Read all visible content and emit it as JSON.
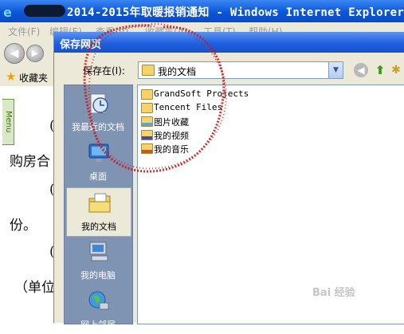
{
  "ie": {
    "title": "2014-2015年取暖报销通知 - Windows Internet Explorer",
    "menu": [
      "文件(F)",
      "编辑(E)",
      "查看(V)",
      "收藏夹(A)",
      "工具(T)",
      "帮助(H)"
    ],
    "favorites_label": "收藏夹",
    "sidebar_tab": "Menu",
    "document_lines": [
      "(",
      "购房合",
      "(",
      "份。",
      "(",
      "（单位"
    ]
  },
  "dialog": {
    "title": "保存网页",
    "save_in_label": "保存在(I):",
    "save_in_value": "我的文档",
    "places": [
      {
        "label": "我最近的文档",
        "icon": "recent-documents-icon"
      },
      {
        "label": "桌面",
        "icon": "desktop-icon"
      },
      {
        "label": "我的文档",
        "icon": "my-documents-icon"
      },
      {
        "label": "我的电脑",
        "icon": "my-computer-icon"
      },
      {
        "label": "网上邻居",
        "icon": "network-places-icon"
      }
    ],
    "files": [
      {
        "name": "GrandSoft Projects",
        "icon": "folder-icon"
      },
      {
        "name": "Tencent Files",
        "icon": "folder-icon"
      },
      {
        "name": "图片收藏",
        "icon": "pictures-folder-icon"
      },
      {
        "name": "我的视频",
        "icon": "video-folder-icon"
      },
      {
        "name": "我的音乐",
        "icon": "music-folder-icon"
      }
    ]
  },
  "watermark": "Bai 经验",
  "colors": {
    "title_blue": "#0b56d9",
    "dialog_face": "#ece9d8",
    "places_bar": "#7f93b2",
    "annotation_red": "#c41a1a"
  }
}
